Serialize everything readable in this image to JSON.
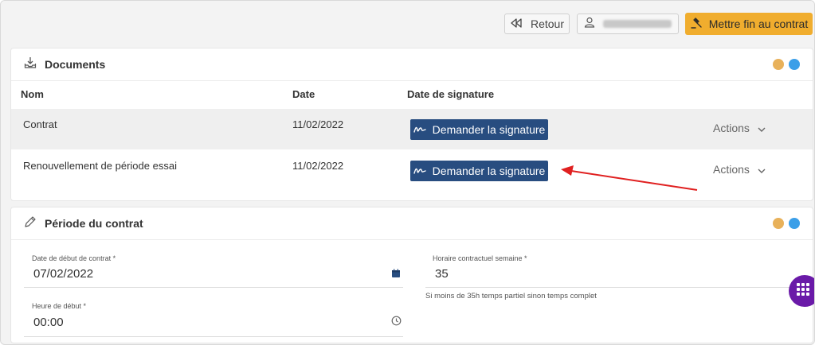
{
  "header": {
    "back_label": "Retour",
    "end_contract_label": "Mettre fin au contrat"
  },
  "documents": {
    "title": "Documents",
    "columns": {
      "name": "Nom",
      "date": "Date",
      "signature": "Date de signature"
    },
    "rows": [
      {
        "name": "Contrat",
        "date": "11/02/2022",
        "sign_label": "Demander la signature",
        "actions_label": "Actions"
      },
      {
        "name": "Renouvellement de période essai",
        "date": "11/02/2022",
        "sign_label": "Demander la signature",
        "actions_label": "Actions"
      }
    ]
  },
  "period": {
    "title": "Période du contrat",
    "start_date": {
      "label": "Date de début de contrat *",
      "value": "07/02/2022"
    },
    "weekly_hours": {
      "label": "Horaire contractuel semaine *",
      "value": "35",
      "hint": "Si moins de 35h temps partiel sinon temps complet"
    },
    "start_time": {
      "label": "Heure de début *",
      "value": "00:00"
    }
  },
  "colors": {
    "accent_orange": "#f0ad2e",
    "dot_orange": "#e8b15a",
    "dot_blue": "#3b9fe8",
    "signature_button": "#284d80",
    "fab": "#6a1aa8",
    "annotation_arrow": "#e02020"
  }
}
